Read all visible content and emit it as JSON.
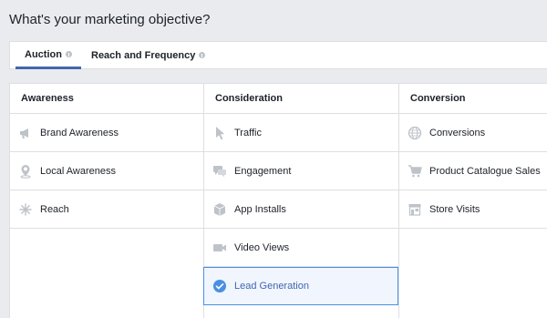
{
  "page": {
    "title": "What's your marketing objective?"
  },
  "tabs": [
    {
      "label": "Auction",
      "active": true
    },
    {
      "label": "Reach and Frequency",
      "active": false
    }
  ],
  "columns": [
    {
      "header": "Awareness",
      "items": [
        {
          "label": "Brand Awareness",
          "icon": "megaphone-icon"
        },
        {
          "label": "Local Awareness",
          "icon": "location-pin-icon"
        },
        {
          "label": "Reach",
          "icon": "snowflake-icon"
        }
      ]
    },
    {
      "header": "Consideration",
      "items": [
        {
          "label": "Traffic",
          "icon": "cursor-icon"
        },
        {
          "label": "Engagement",
          "icon": "chat-bubbles-icon"
        },
        {
          "label": "App Installs",
          "icon": "box-icon"
        },
        {
          "label": "Video Views",
          "icon": "video-camera-icon"
        },
        {
          "label": "Lead Generation",
          "icon": "check-circle-icon",
          "selected": true
        }
      ]
    },
    {
      "header": "Conversion",
      "items": [
        {
          "label": "Conversions",
          "icon": "globe-icon"
        },
        {
          "label": "Product Catalogue Sales",
          "icon": "shopping-cart-icon"
        },
        {
          "label": "Store Visits",
          "icon": "store-icon"
        }
      ]
    }
  ],
  "colors": {
    "accent": "#4267b2",
    "selected_border": "#4a90e2",
    "icon_gray": "#bec3c9"
  }
}
